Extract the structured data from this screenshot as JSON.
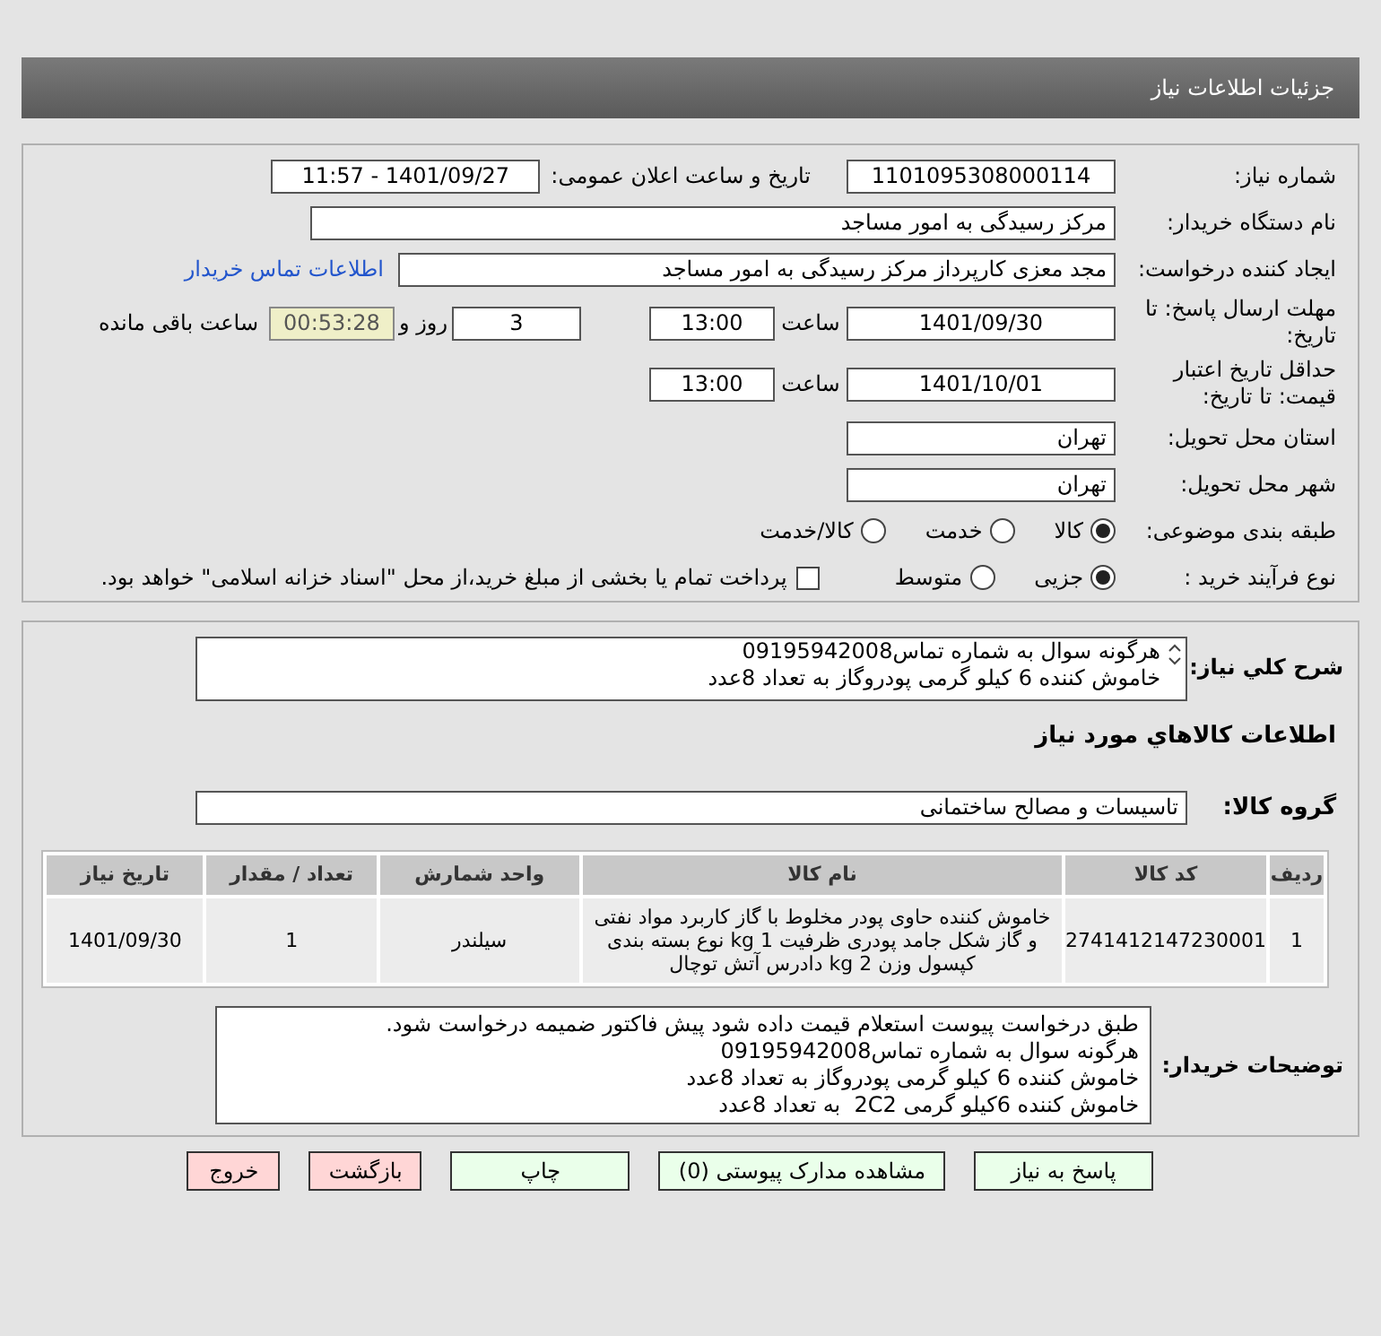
{
  "page_title": "جزئیات اطلاعات نیاز",
  "need_info": {
    "need_number": {
      "label": "شماره نیاز:",
      "value": "1101095308000114"
    },
    "announce": {
      "label": "تاریخ و ساعت اعلان عمومی:",
      "value": "1401/09/27 - 11:57"
    },
    "buyer": {
      "label": "نام دستگاه خریدار:",
      "value": "مرکز رسیدگی به امور مساجد"
    },
    "creator": {
      "label": "ایجاد کننده درخواست:",
      "value": "مجد معزی کارپرداز مرکز رسیدگی به امور مساجد",
      "link": "اطلاعات تماس خریدار"
    },
    "deadline": {
      "label": "مهلت ارسال پاسخ: تا تاریخ:",
      "date": "1401/09/30",
      "time_label": "ساعت",
      "time": "13:00",
      "days": "3",
      "days_label": "روز و",
      "remaining": "00:53:28",
      "remaining_label": "ساعت باقی مانده"
    },
    "validity": {
      "label": "حداقل تاریخ اعتبار قیمت: تا تاریخ:",
      "date": "1401/10/01",
      "time_label": "ساعت",
      "time": "13:00"
    },
    "province": {
      "label": "استان محل تحویل:",
      "value": "تهران"
    },
    "city": {
      "label": "شهر محل تحویل:",
      "value": "تهران"
    },
    "category": {
      "label": "طبقه بندی موضوعی:",
      "options": [
        {
          "label": "کالا",
          "selected": true
        },
        {
          "label": "خدمت",
          "selected": false
        },
        {
          "label": "کالا/خدمت",
          "selected": false
        }
      ]
    },
    "process": {
      "label": "نوع فرآیند خرید :",
      "options": [
        {
          "label": "جزیی",
          "selected": true
        },
        {
          "label": "متوسط",
          "selected": false
        }
      ],
      "treasury": {
        "label": "پرداخت تمام یا بخشی از مبلغ خرید،از محل \"اسناد خزانه اسلامی\" خواهد بود.",
        "checked": false
      }
    }
  },
  "details": {
    "description": {
      "label": "شرح کلي نياز:",
      "lines": [
        "هرگونه سوال به شماره تماس09195942008",
        "خاموش کننده 6 کیلو گرمی پودروگاز به تعداد 8عدد"
      ]
    },
    "goods_title": "اطلاعات کالاهاي مورد نياز",
    "group": {
      "label": "گروه کالا:",
      "value": "تاسیسات و مصالح ساختمانی"
    },
    "table": {
      "columns": [
        "ردیف",
        "کد کالا",
        "نام کالا",
        "واحد شمارش",
        "تعداد / مقدار",
        "تاریخ نیاز"
      ],
      "rows": [
        [
          "1",
          "2741412147230001",
          "خاموش کننده حاوی پودر مخلوط با گاز کاربرد مواد نفتی و گاز شکل جامد پودری ظرفیت 1 kg نوع بسته بندی کپسول وزن 2 kg دادرس آتش توچال",
          "سیلندر",
          "1",
          "1401/09/30"
        ]
      ]
    },
    "buyer_notes": {
      "label": "توضیحات خریدار:",
      "lines": [
        "طبق درخواست پیوست استعلام قیمت داده شود پیش فاکتور ضمیمه درخواست شود.",
        "هرگونه سوال به شماره تماس09195942008",
        "خاموش کننده 6 کیلو گرمی پودروگاز به تعداد 8عدد",
        "خاموش کننده 6کیلو گرمی 2C2  به تعداد 8عدد"
      ]
    }
  },
  "buttons": [
    {
      "label": "پاسخ به نیاز",
      "kind": "normal"
    },
    {
      "label": "مشاهده مدارک پیوستی (0)",
      "kind": "normal"
    },
    {
      "label": "چاپ",
      "kind": "normal"
    },
    {
      "label": "بازگشت",
      "kind": "danger"
    },
    {
      "label": "خروج",
      "kind": "danger"
    }
  ]
}
